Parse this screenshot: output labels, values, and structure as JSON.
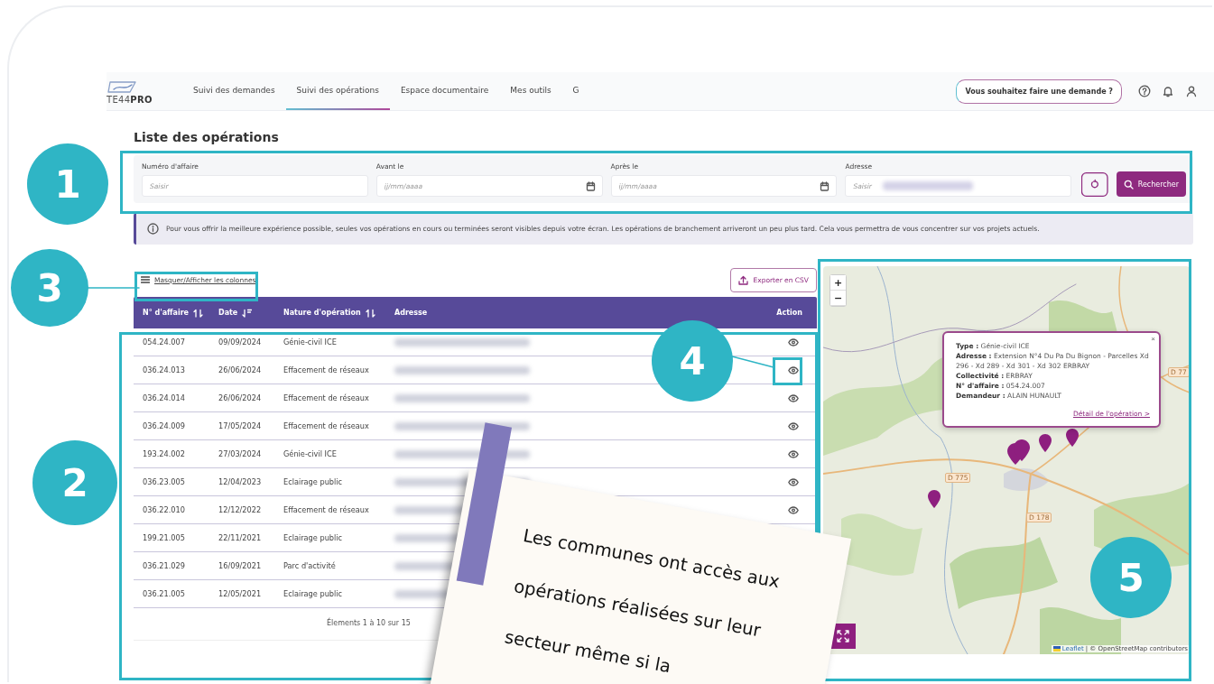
{
  "header": {
    "logo": {
      "text": "TE44",
      "bold": "PRO"
    },
    "tabs": [
      {
        "label": "Suivi des demandes",
        "selected": false
      },
      {
        "label": "Suivi des opérations",
        "selected": true
      },
      {
        "label": "Espace documentaire",
        "selected": false
      },
      {
        "label": "Mes outils",
        "selected": false
      },
      {
        "label": "G",
        "selected": false
      }
    ],
    "request_button": "Vous souhaitez faire une demande ?"
  },
  "page_title": "Liste des opérations",
  "filters": {
    "fields": [
      {
        "label": "Numéro d'affaire",
        "placeholder": "Saisir",
        "kind": "text"
      },
      {
        "label": "Avant le",
        "placeholder": "jj/mm/aaaa",
        "kind": "date"
      },
      {
        "label": "Après le",
        "placeholder": "jj/mm/aaaa",
        "kind": "date"
      },
      {
        "label": "Adresse",
        "placeholder": "Saisir",
        "kind": "address"
      }
    ],
    "search_button": "Rechercher"
  },
  "info_banner": "Pour vous offrir la meilleure expérience possible, seules vos opérations en cours ou terminées seront visibles depuis votre écran. Les opérations de branchement arriveront un peu plus tard. Cela vous permettra de vous concentrer sur vos projets actuels.",
  "columns_toggle": "Masquer/Afficher les colonnes",
  "export_button": "Exporter en CSV",
  "table": {
    "columns": [
      {
        "label": "N° d'affaire",
        "sortable": true,
        "sorted_desc": false
      },
      {
        "label": "Date",
        "sortable": true,
        "sorted_desc": true
      },
      {
        "label": "Nature d'opération",
        "sortable": true,
        "sorted_desc": false
      },
      {
        "label": "Adresse",
        "sortable": false,
        "sorted_desc": false
      },
      {
        "label": "Action",
        "sortable": false,
        "sorted_desc": false
      }
    ],
    "rows": [
      {
        "cells": [
          "054.24.007",
          "09/09/2024",
          "Génie-civil ICE"
        ]
      },
      {
        "cells": [
          "036.24.013",
          "26/06/2024",
          "Effacement de réseaux"
        ]
      },
      {
        "cells": [
          "036.24.014",
          "26/06/2024",
          "Effacement de réseaux"
        ]
      },
      {
        "cells": [
          "036.24.009",
          "17/05/2024",
          "Effacement de réseaux"
        ]
      },
      {
        "cells": [
          "193.24.002",
          "27/03/2024",
          "Génie-civil ICE"
        ]
      },
      {
        "cells": [
          "036.23.005",
          "12/04/2023",
          "Eclairage public"
        ]
      },
      {
        "cells": [
          "036.22.010",
          "12/12/2022",
          "Effacement de réseaux"
        ]
      },
      {
        "cells": [
          "199.21.005",
          "22/11/2021",
          "Eclairage public"
        ]
      },
      {
        "cells": [
          "036.21.029",
          "16/09/2021",
          "Parc d'activité"
        ]
      },
      {
        "cells": [
          "036.21.005",
          "12/05/2021",
          "Eclairage public"
        ]
      }
    ]
  },
  "pagination": "Élements 1 à 10 sur 15",
  "map": {
    "zoom_in": "+",
    "zoom_out": "−",
    "popup": {
      "lines": [
        "**Type :** Génie-civil ICE",
        "**Adresse :** Extension N°4 Du Pa Du Bignon - Parcelles Xd 296 - Xd 289 - Xd 301 - Xd 302 ERBRAY",
        "**Collectivité :** ERBRAY",
        "**N° d'affaire :** 054.24.007",
        "**Demandeur :** ALAIN HUNAULT"
      ],
      "close": "×",
      "link": "Détail de l'opération >"
    },
    "road_labels": [
      "D 775",
      "D 178",
      "D 77"
    ],
    "attribution_link": "Leaflet",
    "attribution": "| © OpenStreetMap contributors"
  },
  "annotations": [
    {
      "number": "1"
    },
    {
      "number": "3"
    },
    {
      "number": "2"
    },
    {
      "number": "4"
    },
    {
      "number": "5"
    }
  ],
  "note": {
    "lines": [
      "Les communes ont accès aux",
      "opérations réalisées sur leur",
      "secteur même si la"
    ]
  }
}
